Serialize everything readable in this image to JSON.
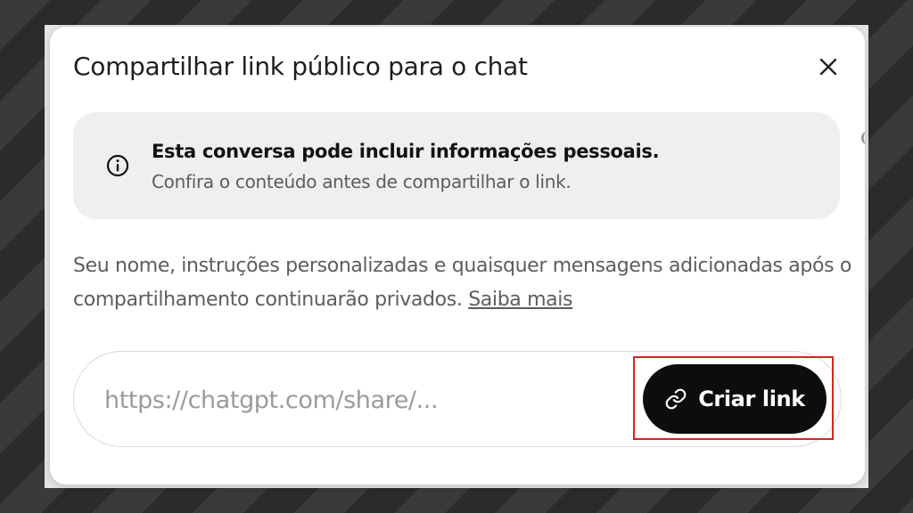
{
  "dialog": {
    "title": "Compartilhar link público para o chat",
    "close_icon": "close-icon"
  },
  "notice": {
    "icon": "info-icon",
    "heading": "Esta conversa pode incluir informações pessoais.",
    "subtext": "Confira o conteúdo antes de compartilhar o link."
  },
  "description": {
    "text": "Seu nome, instruções personalizadas e quaisquer mensagens adicionadas após o compartilhamento continuarão privados.",
    "link_text": "Saiba mais"
  },
  "share": {
    "url_placeholder": "https://chatgpt.com/share/...",
    "button_label": "Criar link",
    "button_icon": "link-icon"
  },
  "colors": {
    "button_bg": "#0d0d0d",
    "notice_bg": "#efefef",
    "highlight_border": "#d9231f"
  }
}
